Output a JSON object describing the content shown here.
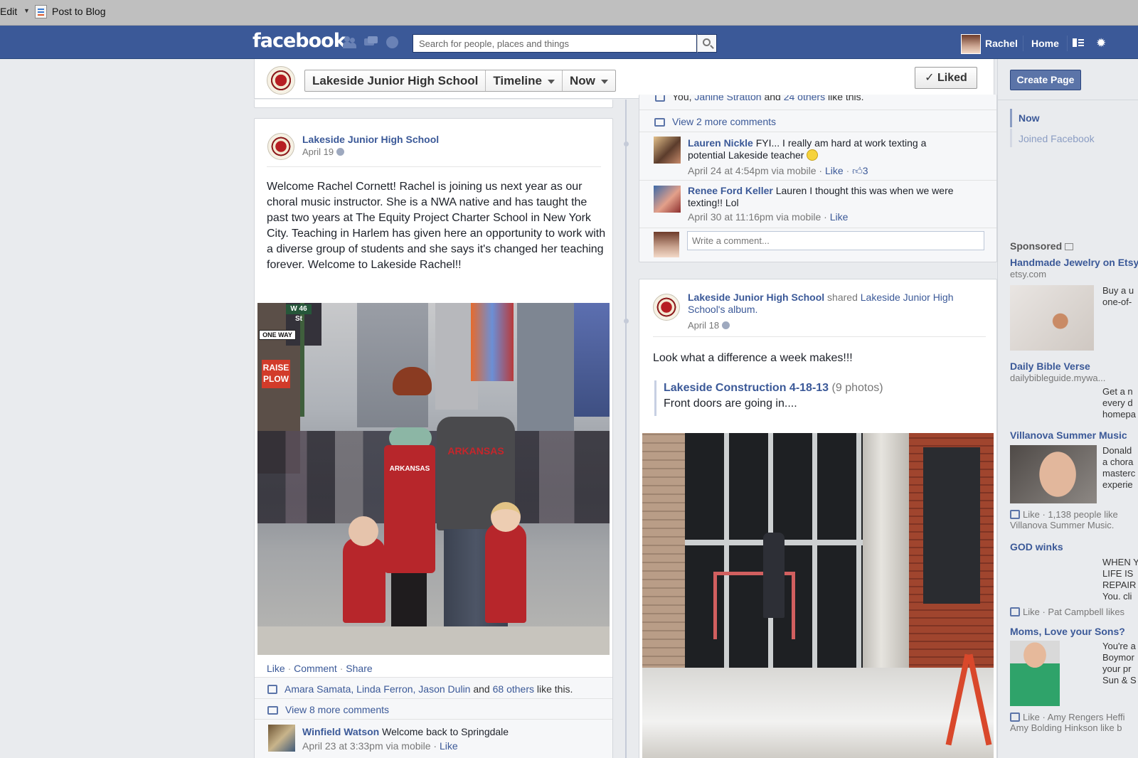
{
  "os_bar": {
    "edit_label": "Edit",
    "post_to_blog_label": "Post to Blog"
  },
  "topbar": {
    "logo": "facebook",
    "search_placeholder": "Search for people, places and things",
    "user_name": "Rachel",
    "home_label": "Home"
  },
  "page_header": {
    "page_name": "Lakeside Junior High School",
    "timeline_label": "Timeline",
    "now_label": "Now",
    "liked_label": "✓ Liked"
  },
  "post1": {
    "author": "Lakeside Junior High School",
    "date": "April 19",
    "text": "Welcome Rachel Cornett! Rachel is joining us next year as our choral music instructor. She is a NWA native and has taught the past two years at The Equity Project Charter School in New York City. Teaching in Harlem has given here an opportunity to work with a diverse group of students and she says it's changed her teaching forever. Welcome to Lakeside Rachel!!",
    "photo_signs": {
      "street": "W 46 St",
      "one_way": "ONE WAY",
      "raise_plow": "RAISE PLOW",
      "shirt": "ARKANSAS"
    },
    "actions": {
      "like": "Like",
      "comment": "Comment",
      "share": "Share",
      "sep": "·"
    },
    "likes": {
      "names": "Amara Samata, Linda Ferron, Jason Dulin",
      "and": "and",
      "others": "68 others",
      "suffix": "like this."
    },
    "view_more": "View 8 more comments",
    "comment": {
      "author": "Winfield Watson",
      "text": "Welcome back to Springdale",
      "meta": "April 23 at 3:33pm via mobile ·",
      "like": "Like"
    }
  },
  "post2": {
    "likes_partial": {
      "you": "You,",
      "name": "Janine Stratton",
      "and": "and",
      "others": "24 others",
      "suffix": "like this."
    },
    "view_more": "View 2 more comments",
    "comments": [
      {
        "author": "Lauren Nickle",
        "text1": "FYI... I really am hard at work texting a",
        "text2": "potential Lakeside teacher",
        "meta": "April 24 at 4:54pm via mobile ·",
        "like": "Like",
        "like_count": "3"
      },
      {
        "author": "Renee Ford Keller",
        "text1": "Lauren I thought this was when we were",
        "text2": "texting!! Lol",
        "meta": "April 30 at 11:16pm via mobile ·",
        "like": "Like"
      }
    ],
    "comment_placeholder": "Write a comment..."
  },
  "post3": {
    "author": "Lakeside Junior High School",
    "shared": "shared",
    "album_owner_line1": "Lakeside Junior High",
    "album_owner_line2": "School's album.",
    "date": "April 18",
    "text": "Look what a difference a week makes!!!",
    "album_title": "Lakeside Construction 4-18-13",
    "album_count": "(9 photos)",
    "album_desc": "Front doors are going in...."
  },
  "rail": {
    "create_page": "Create Page",
    "nav": [
      "Now",
      "Joined Facebook"
    ],
    "sponsored": "Sponsored",
    "ads": [
      {
        "title": "Handmade Jewelry on Etsy",
        "sub": "etsy.com",
        "text": [
          "Buy a u",
          "one-of-"
        ]
      },
      {
        "title": "Daily Bible Verse",
        "sub": "dailybibleguide.mywa...",
        "text": [
          "Get a n",
          "every d",
          "homepa"
        ]
      },
      {
        "title": "Villanova Summer Music",
        "sub": "",
        "text": [
          "Donald",
          "a chora",
          "masterc",
          "experie"
        ],
        "like_line1": "Like · 1,138 people like",
        "like_line2": "Villanova Summer Music."
      },
      {
        "title": "GOD winks",
        "sub": "",
        "text": [
          "WHEN Y",
          "LIFE IS",
          "REPAIR",
          "You. cli"
        ],
        "like_line1": "Like · Pat Campbell likes"
      },
      {
        "title": "Moms, Love your Sons?",
        "sub": "",
        "text": [
          "You're a",
          "Boymor",
          "your pr",
          "Sun & S"
        ],
        "like_line1": "Like · Amy Rengers Heffi",
        "like_line2": "Amy Bolding Hinkson like b"
      }
    ]
  },
  "colors": {
    "fb_blue": "#3b5998",
    "link": "#3b5998",
    "seal_red": "#b71e23"
  }
}
